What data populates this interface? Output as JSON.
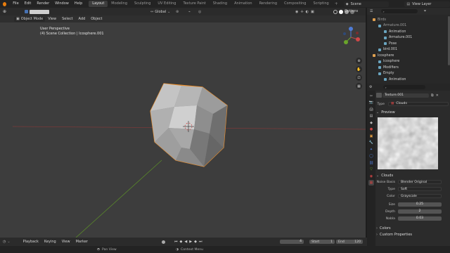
{
  "topbar": {
    "menus": [
      "File",
      "Edit",
      "Render",
      "Window",
      "Help"
    ],
    "workspaces": [
      "Layout",
      "Modeling",
      "Sculpting",
      "UV Editing",
      "Texture Paint",
      "Shading",
      "Animation",
      "Rendering",
      "Compositing",
      "Scripting"
    ],
    "active_workspace": "Layout",
    "scene_label": "Scene",
    "view_layer_label": "View Layer"
  },
  "viewport_header": {
    "mode": "Object Mode",
    "menus": [
      "View",
      "Select",
      "Add",
      "Object"
    ],
    "transform_orientation": "Global",
    "options_label": "Options"
  },
  "viewport": {
    "perspective_label": "User Perspective",
    "collection_label": "(4) Scene Collection | Icosphere.001"
  },
  "outliner": {
    "items": [
      {
        "label": "Birds",
        "indent": 0,
        "color": "#9b9b9b"
      },
      {
        "label": "Armature.001",
        "indent": 1,
        "color": "#9b9b9b"
      },
      {
        "label": "Animation",
        "indent": 2,
        "color": "#cfcfcf"
      },
      {
        "label": "Armature.001",
        "indent": 2,
        "color": "#cfcfcf"
      },
      {
        "label": "Pose",
        "indent": 2,
        "color": "#cfcfcf"
      },
      {
        "label": "bird.001",
        "indent": 1,
        "color": "#cfcfcf"
      },
      {
        "label": "Icosphere",
        "indent": 0,
        "color": "#cfcfcf"
      },
      {
        "label": "Icosphere",
        "indent": 1,
        "color": "#cfcfcf"
      },
      {
        "label": "Modifiers",
        "indent": 1,
        "color": "#cfcfcf"
      },
      {
        "label": "Empty",
        "indent": 1,
        "color": "#cfcfcf"
      },
      {
        "label": "Animation",
        "indent": 2,
        "color": "#cfcfcf"
      }
    ]
  },
  "properties": {
    "texture_name": "Texture.001",
    "type_label": "Type",
    "type_value": "Clouds",
    "preview_label": "Preview",
    "clouds_label": "Clouds",
    "noise_basis_label": "Noise Basis",
    "noise_basis_value": "Blender Original",
    "noise_type_label": "Type",
    "noise_type_value": "Soft",
    "color_label": "Color",
    "color_value": "Grayscale",
    "size_label": "Size",
    "size_value": "0.25",
    "depth_label": "Depth",
    "depth_value": "2",
    "nabla_label": "Nabla",
    "nabla_value": "0.03",
    "colors_section": "Colors",
    "custom_props_section": "Custom Properties"
  },
  "timeline": {
    "menus": [
      "Playback",
      "Keying",
      "View",
      "Marker"
    ],
    "current_frame": "4",
    "start_label": "Start",
    "start_value": "1",
    "end_label": "End",
    "end_value": "120"
  },
  "statusbar": {
    "pan_view": "Pan View",
    "context_menu": "Context Menu"
  },
  "colors": {
    "accent_blue": "#4772b3",
    "selection_orange": "#f0902a",
    "axis_red": "#b03a3a",
    "axis_green": "#6a9a2a"
  }
}
